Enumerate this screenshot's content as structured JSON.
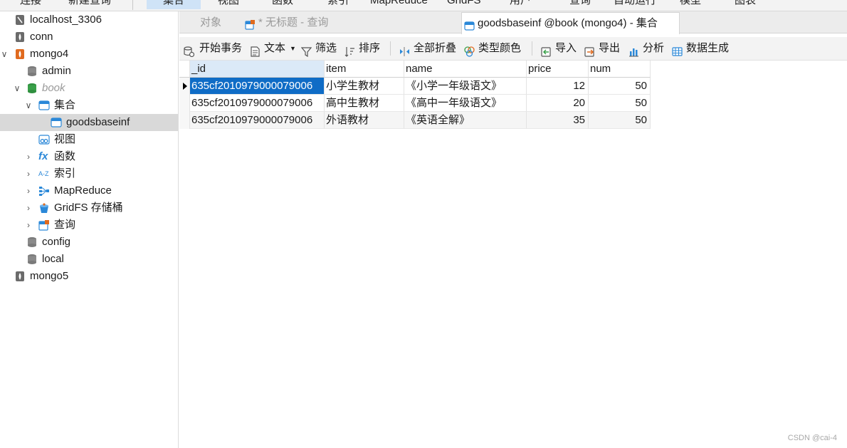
{
  "top_toolbar": {
    "items": [
      "连接",
      "新建查询",
      "集合",
      "视图",
      "函数",
      "索引",
      "MapReduce",
      "GridFS",
      "用户",
      "查询",
      "自动运行",
      "模型",
      "图表"
    ]
  },
  "sidebar": {
    "items": [
      {
        "label": "localhost_3306",
        "icon": "server-icon"
      },
      {
        "label": "conn",
        "icon": "server-icon"
      },
      {
        "label": "mongo4",
        "icon": "mongodb-leaf-icon"
      },
      {
        "label": "admin",
        "icon": "database-icon"
      },
      {
        "label": "book",
        "icon": "database-icon"
      },
      {
        "label": "集合",
        "icon": "collection-icon"
      },
      {
        "label": "goodsbaseinf",
        "icon": "collection-icon"
      },
      {
        "label": "视图",
        "icon": "view-icon"
      },
      {
        "label": "函数",
        "icon": "function-icon"
      },
      {
        "label": "索引",
        "icon": "index-icon"
      },
      {
        "label": "MapReduce",
        "icon": "mapreduce-icon"
      },
      {
        "label": "GridFS 存储桶",
        "icon": "gridfs-bucket-icon"
      },
      {
        "label": "查询",
        "icon": "query-icon"
      },
      {
        "label": "config",
        "icon": "database-icon"
      },
      {
        "label": "local",
        "icon": "database-icon"
      },
      {
        "label": "mongo5",
        "icon": "server-icon"
      }
    ]
  },
  "tabs": [
    {
      "label": "对象"
    },
    {
      "label": "* 无标题 - 查询"
    },
    {
      "label": "goodsbaseinf @book (mongo4) - 集合"
    }
  ],
  "actions": [
    {
      "label": "开始事务",
      "icon": "transaction-icon"
    },
    {
      "label": "文本",
      "icon": "text-icon"
    },
    {
      "label": "筛选",
      "icon": "filter-icon"
    },
    {
      "label": "排序",
      "icon": "sort-icon"
    },
    {
      "label": "全部折叠",
      "icon": "collapse-icon"
    },
    {
      "label": "类型颜色",
      "icon": "color-icon"
    },
    {
      "label": "导入",
      "icon": "import-icon"
    },
    {
      "label": "导出",
      "icon": "export-icon"
    },
    {
      "label": "分析",
      "icon": "analyze-icon"
    },
    {
      "label": "数据生成",
      "icon": "data-generate-icon"
    }
  ],
  "grid": {
    "columns": [
      "_id",
      "item",
      "name",
      "price",
      "num"
    ],
    "rows": [
      [
        "635cf2010979000079006",
        "小学生教材",
        "《小学一年级语文》",
        "12",
        "50"
      ],
      [
        "635cf2010979000079006",
        "高中生教材",
        "《高中一年级语文》",
        "20",
        "50"
      ],
      [
        "635cf2010979000079006",
        "外语教材",
        "《英语全解》",
        "35",
        "50"
      ]
    ]
  },
  "watermark": "CSDN @cai-4",
  "colors": {
    "selection": "#0f6cc6",
    "accent_orange": "#e06a1e",
    "mongodb_green": "#3aa04a",
    "tree_selected": "#d9d9d9"
  }
}
